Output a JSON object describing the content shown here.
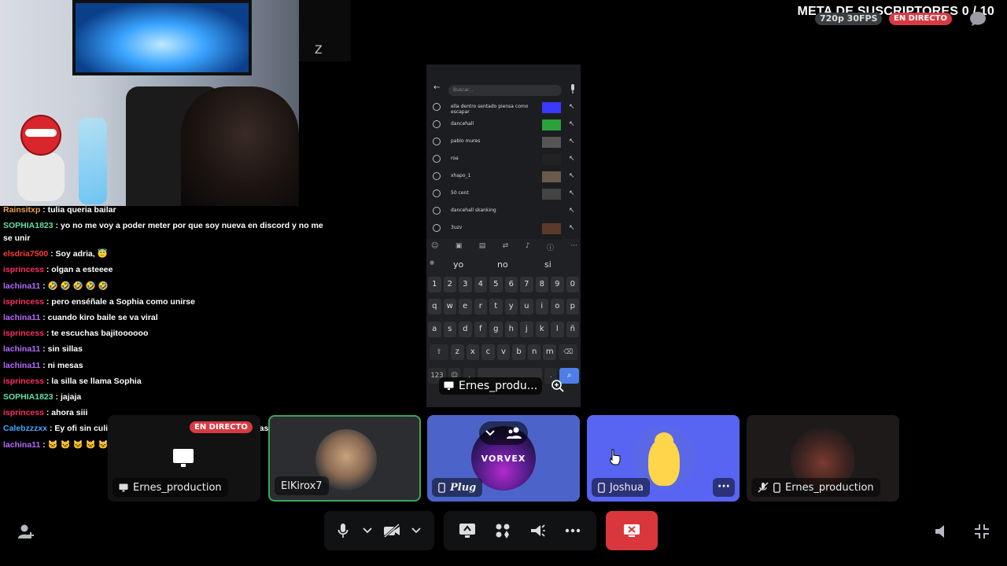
{
  "overlay": {
    "goal": "META DE SUSCRIPTORES 0 / 10",
    "quality": "720p 30FPS",
    "live": "EN DIRECTO"
  },
  "chat": {
    "messages": [
      {
        "user": "Rainsitxp",
        "color": "#e8a24a",
        "text": " : tulia queria bailar"
      },
      {
        "user": "SOPHIA1823",
        "color": "#5ee1a4",
        "text": " : yo no me voy a poder meter por que soy nueva en discord y no me se unir"
      },
      {
        "user": "elsdria7500",
        "color": "#ff3b3b",
        "text": " : Soy adria, 😇"
      },
      {
        "user": "isprincess",
        "color": "#ff2e63",
        "text": " : olgan a esteeee"
      },
      {
        "user": "lachina11",
        "color": "#b36bff",
        "text": " : 🤣 🤣 🤣 🤣 🤣"
      },
      {
        "user": "isprincess",
        "color": "#ff2e63",
        "text": " : pero enséñale a Sophia como unirse"
      },
      {
        "user": "lachina11",
        "color": "#b36bff",
        "text": " : cuando kiro baile se va viral"
      },
      {
        "user": "isprincess",
        "color": "#ff2e63",
        "text": " : te escuchas bajitoooooo"
      },
      {
        "user": "lachina11",
        "color": "#b36bff",
        "text": " : sin sillas"
      },
      {
        "user": "lachina11",
        "color": "#b36bff",
        "text": " : ni mesas"
      },
      {
        "user": "isprincess",
        "color": "#ff2e63",
        "text": " : la silla se llama Sophia"
      },
      {
        "user": "SOPHIA1823",
        "color": "#5ee1a4",
        "text": " : jajaja"
      },
      {
        "user": "isprincess",
        "color": "#ff2e63",
        "text": " : ahora siii"
      },
      {
        "user": "Calebzzzxx",
        "color": "#4aa3ff",
        "text": " : Ey ofi sin culiar sillas ni mesas solo sabe aser ese paso"
      },
      {
        "user": "lachina11",
        "color": "#b36bff",
        "text": " : 🐱 🐱 🐱 🐱 🐱 🐱 🐱 🐱"
      }
    ]
  },
  "phone": {
    "search_placeholder": "Buscar...",
    "history": [
      "ella dentro sentado piensa como escapar",
      "dancehall",
      "pablo mures",
      "roa",
      "xhapo_1",
      "50 cent",
      "dancehall skanking",
      "3uzv"
    ],
    "suggestions": [
      "yo",
      "no",
      "si"
    ],
    "keys_row1": [
      "1",
      "2",
      "3",
      "4",
      "5",
      "6",
      "7",
      "8",
      "9",
      "0"
    ],
    "keys_row2": [
      "q",
      "w",
      "e",
      "r",
      "t",
      "y",
      "u",
      "i",
      "o",
      "p"
    ],
    "keys_row3": [
      "a",
      "s",
      "d",
      "f",
      "g",
      "h",
      "j",
      "k",
      "l",
      "ñ"
    ],
    "keys_row4": [
      "z",
      "x",
      "c",
      "v",
      "b",
      "n",
      "m"
    ],
    "key_123": "123",
    "share_label": "Ernes_produ..."
  },
  "tiles": [
    {
      "name": "Ernes_production",
      "badge": "EN DIRECTO"
    },
    {
      "name": "ElKirox7"
    },
    {
      "name": "Plug",
      "art": "VORVEX"
    },
    {
      "name": "Joshua"
    },
    {
      "name": "Ernes_production"
    }
  ],
  "colors": {
    "speaking": "#3ba55d",
    "danger": "#da373c",
    "blurple": "#5865f2"
  }
}
